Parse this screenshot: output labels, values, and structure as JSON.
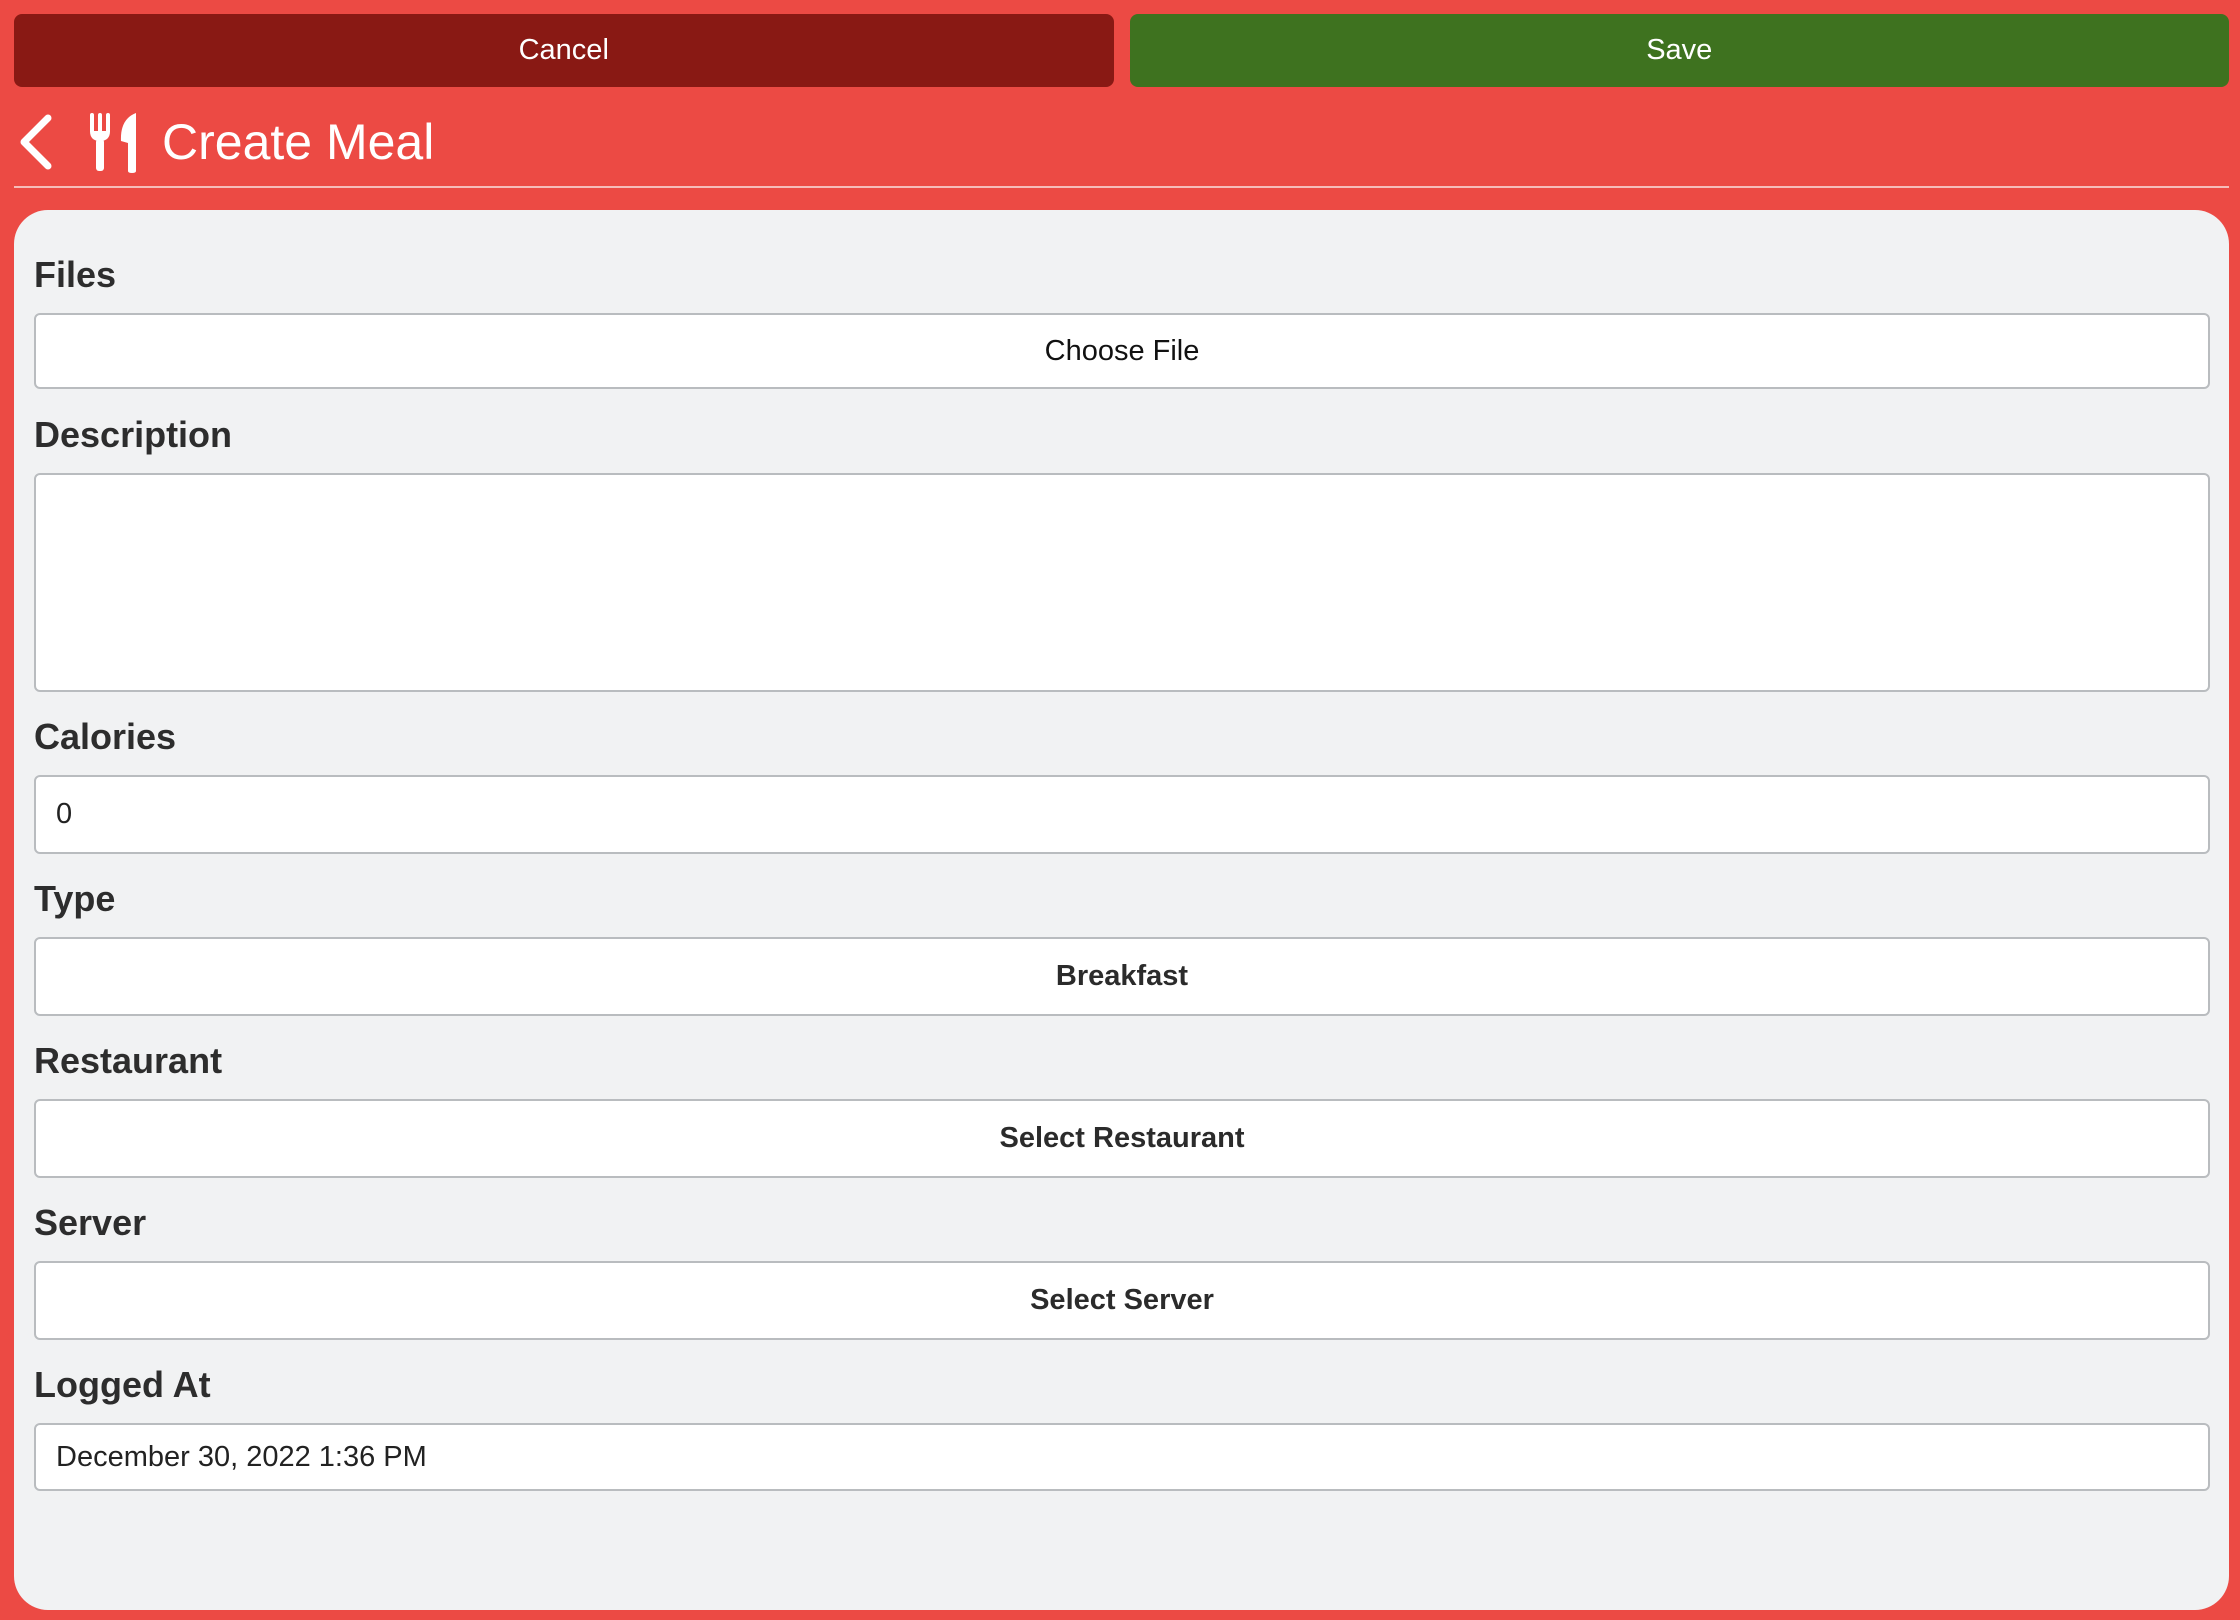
{
  "toolbar": {
    "cancel_label": "Cancel",
    "save_label": "Save"
  },
  "header": {
    "back_icon": "chevron-left-icon",
    "title_icon": "utensils-icon",
    "title": "Create Meal"
  },
  "form": {
    "files": {
      "label": "Files",
      "button": "Choose File"
    },
    "description": {
      "label": "Description",
      "value": ""
    },
    "calories": {
      "label": "Calories",
      "value": "0"
    },
    "type": {
      "label": "Type",
      "value": "Breakfast"
    },
    "restaurant": {
      "label": "Restaurant",
      "value": "Select Restaurant"
    },
    "server": {
      "label": "Server",
      "value": "Select Server"
    },
    "logged_at": {
      "label": "Logged At",
      "value": "December 30, 2022 1:36 PM"
    }
  },
  "colors": {
    "background": "#ec4a44",
    "cancel": "#891914",
    "save": "#3e721f",
    "panel": "#f1f2f3"
  }
}
